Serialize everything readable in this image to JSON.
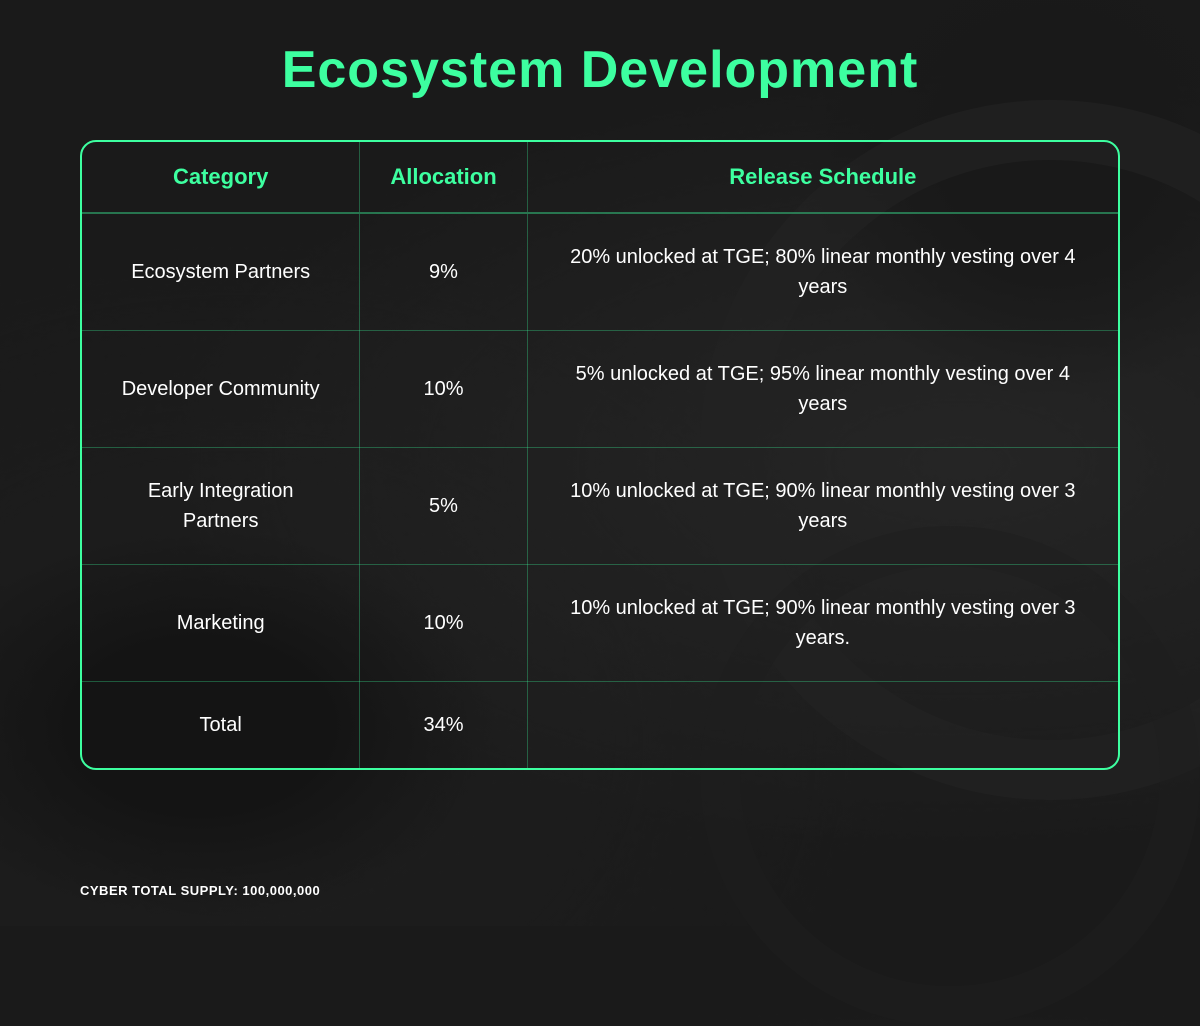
{
  "page": {
    "title": "Ecosystem Development",
    "footer": "CYBER TOTAL SUPPLY: 100,000,000"
  },
  "table": {
    "headers": {
      "category": "Category",
      "allocation": "Allocation",
      "release_schedule": "Release Schedule"
    },
    "rows": [
      {
        "category": "Ecosystem Partners",
        "allocation": "9%",
        "release_schedule": "20% unlocked at TGE; 80% linear monthly vesting over 4 years"
      },
      {
        "category": "Developer Community",
        "allocation": "10%",
        "release_schedule": "5% unlocked at TGE; 95% linear monthly vesting over 4 years"
      },
      {
        "category": "Early Integration Partners",
        "allocation": "5%",
        "release_schedule": "10% unlocked at TGE; 90% linear monthly vesting over 3 years"
      },
      {
        "category": "Marketing",
        "allocation": "10%",
        "release_schedule": "10% unlocked at TGE; 90% linear monthly vesting over 3 years."
      },
      {
        "category": "Total",
        "allocation": "34%",
        "release_schedule": ""
      }
    ]
  }
}
